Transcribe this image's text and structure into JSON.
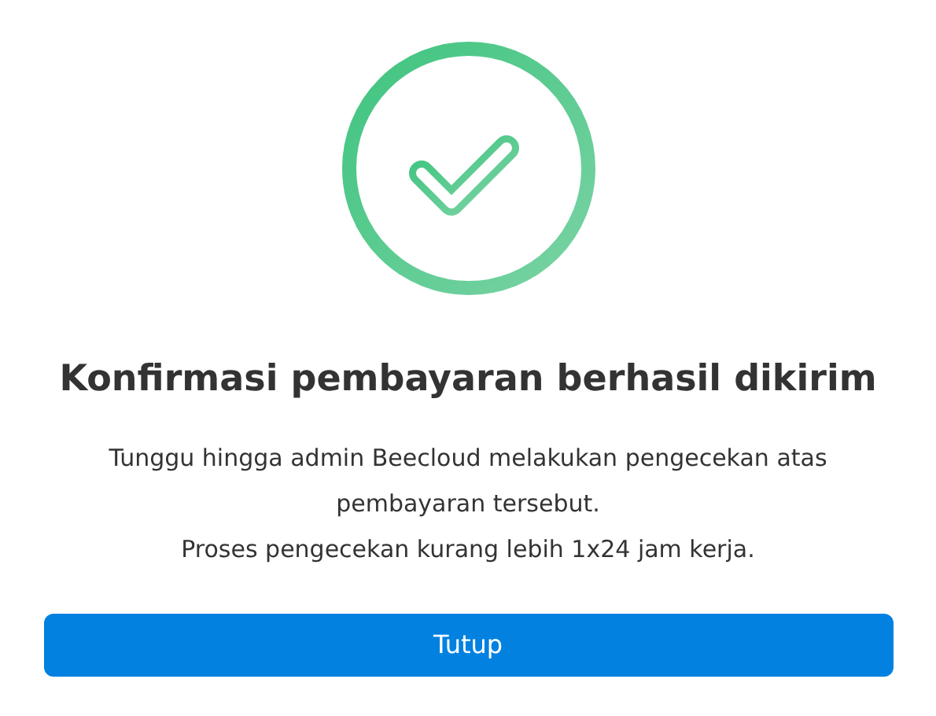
{
  "title": "Konfirmasi pembayaran berhasil dikirim",
  "messages": [
    "Tunggu hingga admin Beecloud melakukan pengecekan atas pembayaran tersebut.",
    "Proses pengecekan kurang lebih 1x24 jam kerja."
  ],
  "button": {
    "label": "Tutup"
  }
}
